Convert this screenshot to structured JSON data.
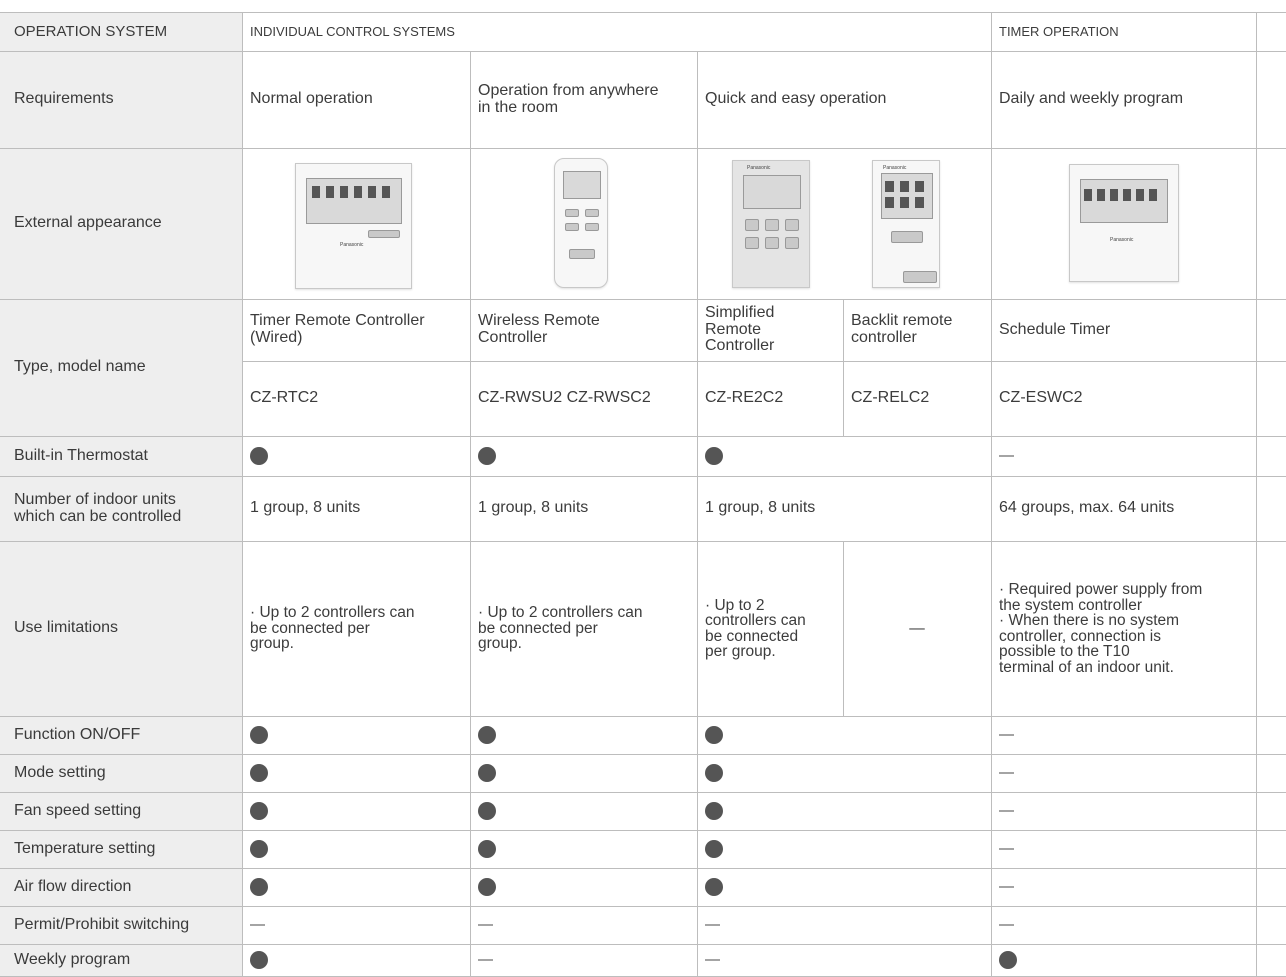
{
  "header": {
    "operation_system": "OPERATION SYSTEM",
    "individual_control_systems": "INDIVIDUAL CONTROL SYSTEMS",
    "timer_operation": "TIMER OPERATION"
  },
  "rows": {
    "requirements": {
      "label": "Requirements",
      "cells": [
        "Normal operation",
        "Operation from anywhere\nin the room",
        "Quick and easy operation",
        "Daily and weekly program"
      ]
    },
    "external_appearance": {
      "label": "External appearance",
      "devices": [
        "timer-remote-controller",
        "wireless-remote-controller",
        "simplified-remote-controller",
        "backlit-remote-controller",
        "schedule-timer"
      ],
      "brand_text": "Panasonic"
    },
    "type_model": {
      "label": "Type, model name",
      "types": [
        "Timer Remote Controller\n(Wired)",
        "Wireless Remote\nController",
        "Simplified\nRemote\nController",
        "Backlit remote\ncontroller",
        "Schedule Timer"
      ],
      "models": [
        "CZ-RTC2",
        "CZ-RWSU2   CZ-RWSC2",
        "CZ-RE2C2",
        "CZ-RELC2",
        "CZ-ESWC2"
      ]
    },
    "thermostat": {
      "label": "Built-in Thermostat",
      "values": [
        "dot",
        "dot",
        "dot",
        "dash"
      ]
    },
    "indoor_units": {
      "label": "Number of indoor units\nwhich can be controlled",
      "values": [
        "1 group, 8 units",
        "1 group, 8 units",
        "1 group, 8 units",
        "64 groups, max. 64 units"
      ]
    },
    "use_limitations": {
      "label": "Use limitations",
      "timer_remote": "· Up to 2 controllers can\n  be connected per\n  group.",
      "wireless_remote": "· Up to 2 controllers can\n  be connected per\n  group.",
      "simplified_remote": "· Up to 2\n  controllers can\n  be connected\n  per group.",
      "backlit_remote": "—",
      "schedule_timer": "· Required power supply from\n  the system controller\n· When there is no system\n  controller, connection is\n  possible to the T10\n  terminal of an indoor unit."
    },
    "features": [
      {
        "label": "Function ON/OFF",
        "values": [
          "dot",
          "dot",
          "dot",
          "dash"
        ]
      },
      {
        "label": "Mode setting",
        "values": [
          "dot",
          "dot",
          "dot",
          "dash"
        ]
      },
      {
        "label": "Fan speed setting",
        "values": [
          "dot",
          "dot",
          "dot",
          "dash"
        ]
      },
      {
        "label": "Temperature setting",
        "values": [
          "dot",
          "dot",
          "dot",
          "dash"
        ]
      },
      {
        "label": "Air flow direction",
        "values": [
          "dot",
          "dot",
          "dot",
          "dash"
        ]
      },
      {
        "label": "Permit/Prohibit switching",
        "values": [
          "dash",
          "dash",
          "dash",
          "dash"
        ]
      },
      {
        "label": "Weekly program",
        "values": [
          "dot",
          "dash",
          "dash",
          "dot"
        ]
      }
    ]
  }
}
